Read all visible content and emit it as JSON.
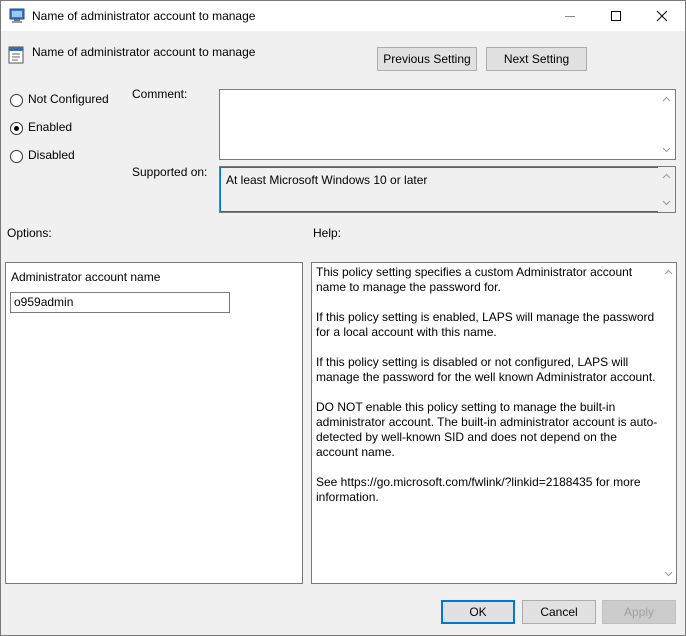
{
  "window": {
    "title": "Name of administrator account to manage"
  },
  "header": {
    "title": "Name of administrator account to manage",
    "prev_button": "Previous Setting",
    "next_button": "Next Setting"
  },
  "state": {
    "options": [
      {
        "label": "Not Configured",
        "selected": false
      },
      {
        "label": "Enabled",
        "selected": true
      },
      {
        "label": "Disabled",
        "selected": false
      }
    ]
  },
  "comment": {
    "label": "Comment:",
    "value": ""
  },
  "supported": {
    "label": "Supported on:",
    "value": "At least Microsoft Windows 10 or later"
  },
  "options_section": {
    "label": "Options:",
    "field_label": "Administrator account name",
    "field_value": "o959admin"
  },
  "help_section": {
    "label": "Help:",
    "paragraphs": [
      "This policy setting specifies a custom Administrator account name to manage the password for.",
      "If this policy setting is enabled, LAPS will manage the password for a local account with this name.",
      "If this policy setting is disabled or not configured, LAPS will manage the password for the well known Administrator account.",
      "DO NOT enable this policy setting to manage the built-in administrator account. The built-in administrator account is auto-detected by well-known SID and does not depend on the account name.",
      "See https://go.microsoft.com/fwlink/?linkid=2188435 for more information."
    ]
  },
  "footer": {
    "ok": "OK",
    "cancel": "Cancel",
    "apply": "Apply"
  },
  "icons": [
    "app-icon",
    "minimize-icon",
    "maximize-icon",
    "close-icon",
    "policy-setting-icon",
    "scroll-up-icon",
    "scroll-down-icon"
  ]
}
